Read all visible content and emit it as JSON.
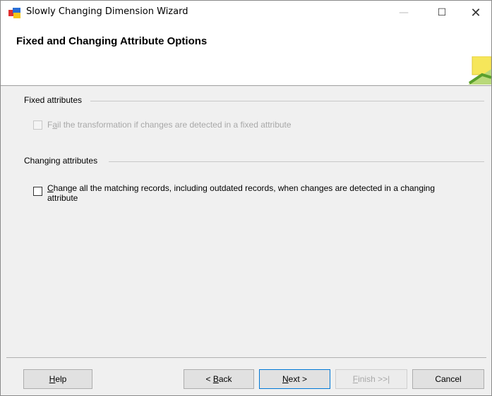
{
  "window": {
    "title": "Slowly Changing Dimension Wizard",
    "minimize_glyph": "—",
    "maximize_glyph": "☐",
    "close_glyph": "✕"
  },
  "header": {
    "title": "Fixed and Changing Attribute Options",
    "graphic_icon": "wizard-graphic-icon"
  },
  "fixed_attributes": {
    "group_label": "Fixed attributes",
    "checkbox": {
      "mnemonic_prefix": "F",
      "mnemonic": "a",
      "rest": "il the transformation if changes are detected in a fixed attribute",
      "checked": false,
      "enabled": false
    }
  },
  "changing_attributes": {
    "group_label": "Changing attributes",
    "checkbox": {
      "mnemonic": "C",
      "line1_rest": "hange all the matching records, including outdated records, when changes are detected in a changing",
      "line2": "attribute",
      "checked": false,
      "enabled": true
    }
  },
  "buttons": {
    "help": {
      "mnemonic": "H",
      "rest": "elp"
    },
    "back": {
      "prefix": "< ",
      "mnemonic": "B",
      "rest": "ack"
    },
    "next": {
      "mnemonic": "N",
      "rest": "ext >"
    },
    "finish": {
      "mnemonic": "F",
      "rest": "inish >>|",
      "enabled": false
    },
    "cancel": {
      "label": "Cancel"
    }
  },
  "colors": {
    "primary_border": "#0078d7",
    "dialog_bg": "#f0f0f0"
  }
}
